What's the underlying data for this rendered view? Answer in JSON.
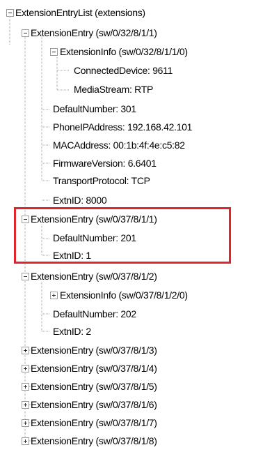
{
  "tree": {
    "root": "ExtensionEntryList (extensions)",
    "entry1": {
      "label": "ExtensionEntry (sw/0/32/8/1/1)",
      "info": {
        "label": "ExtensionInfo (sw/0/32/8/1/1/0)",
        "connected_device": "ConnectedDevice: 9611",
        "media_stream": "MediaStream: RTP"
      },
      "default_number": "DefaultNumber: 301",
      "phone_ip": "PhoneIPAddress: 192.168.42.101",
      "mac": "MACAddress: 00:1b:4f:4e:c5:82",
      "firmware": "FirmwareVersion: 6.6401",
      "transport": "TransportProtocol: TCP",
      "extn_id": "ExtnID: 8000"
    },
    "entry2": {
      "label": "ExtensionEntry (sw/0/37/8/1/1)",
      "default_number": "DefaultNumber: 201",
      "extn_id": "ExtnID: 1"
    },
    "entry3": {
      "label": "ExtensionEntry (sw/0/37/8/1/2)",
      "info": "ExtensionInfo (sw/0/37/8/1/2/0)",
      "default_number": "DefaultNumber: 202",
      "extn_id": "ExtnID: 2"
    },
    "collapsed": [
      "ExtensionEntry (sw/0/37/8/1/3)",
      "ExtensionEntry (sw/0/37/8/1/4)",
      "ExtensionEntry (sw/0/37/8/1/5)",
      "ExtensionEntry (sw/0/37/8/1/6)",
      "ExtensionEntry (sw/0/37/8/1/7)",
      "ExtensionEntry (sw/0/37/8/1/8)"
    ]
  },
  "colors": {
    "highlight": "#e0242b",
    "tree_line": "#a0a0a0"
  }
}
